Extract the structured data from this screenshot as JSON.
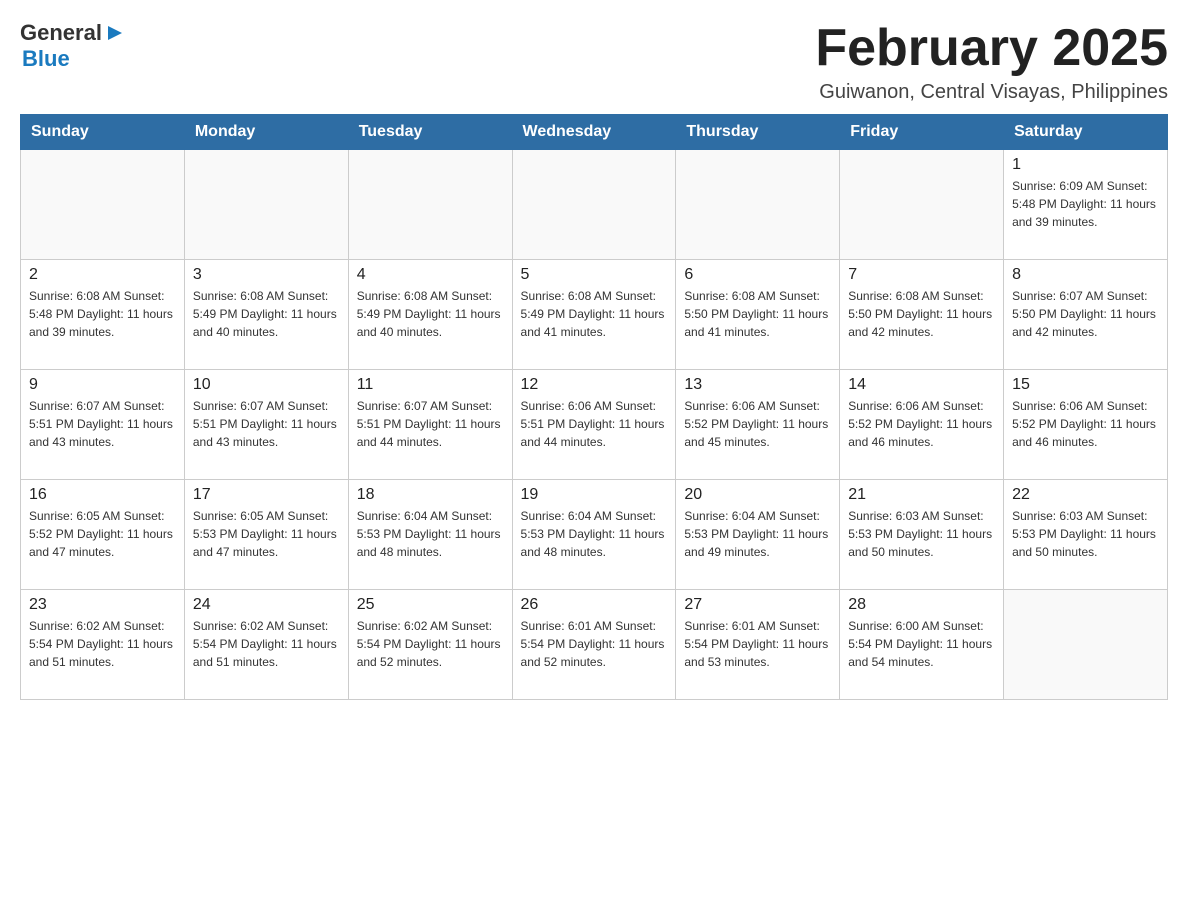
{
  "header": {
    "logo": {
      "text_general": "General",
      "arrow_symbol": "▶",
      "text_blue": "Blue"
    },
    "title": "February 2025",
    "subtitle": "Guiwanon, Central Visayas, Philippines"
  },
  "days_of_week": [
    "Sunday",
    "Monday",
    "Tuesday",
    "Wednesday",
    "Thursday",
    "Friday",
    "Saturday"
  ],
  "weeks": [
    {
      "days": [
        {
          "date": "",
          "info": ""
        },
        {
          "date": "",
          "info": ""
        },
        {
          "date": "",
          "info": ""
        },
        {
          "date": "",
          "info": ""
        },
        {
          "date": "",
          "info": ""
        },
        {
          "date": "",
          "info": ""
        },
        {
          "date": "1",
          "info": "Sunrise: 6:09 AM\nSunset: 5:48 PM\nDaylight: 11 hours and 39 minutes."
        }
      ]
    },
    {
      "days": [
        {
          "date": "2",
          "info": "Sunrise: 6:08 AM\nSunset: 5:48 PM\nDaylight: 11 hours and 39 minutes."
        },
        {
          "date": "3",
          "info": "Sunrise: 6:08 AM\nSunset: 5:49 PM\nDaylight: 11 hours and 40 minutes."
        },
        {
          "date": "4",
          "info": "Sunrise: 6:08 AM\nSunset: 5:49 PM\nDaylight: 11 hours and 40 minutes."
        },
        {
          "date": "5",
          "info": "Sunrise: 6:08 AM\nSunset: 5:49 PM\nDaylight: 11 hours and 41 minutes."
        },
        {
          "date": "6",
          "info": "Sunrise: 6:08 AM\nSunset: 5:50 PM\nDaylight: 11 hours and 41 minutes."
        },
        {
          "date": "7",
          "info": "Sunrise: 6:08 AM\nSunset: 5:50 PM\nDaylight: 11 hours and 42 minutes."
        },
        {
          "date": "8",
          "info": "Sunrise: 6:07 AM\nSunset: 5:50 PM\nDaylight: 11 hours and 42 minutes."
        }
      ]
    },
    {
      "days": [
        {
          "date": "9",
          "info": "Sunrise: 6:07 AM\nSunset: 5:51 PM\nDaylight: 11 hours and 43 minutes."
        },
        {
          "date": "10",
          "info": "Sunrise: 6:07 AM\nSunset: 5:51 PM\nDaylight: 11 hours and 43 minutes."
        },
        {
          "date": "11",
          "info": "Sunrise: 6:07 AM\nSunset: 5:51 PM\nDaylight: 11 hours and 44 minutes."
        },
        {
          "date": "12",
          "info": "Sunrise: 6:06 AM\nSunset: 5:51 PM\nDaylight: 11 hours and 44 minutes."
        },
        {
          "date": "13",
          "info": "Sunrise: 6:06 AM\nSunset: 5:52 PM\nDaylight: 11 hours and 45 minutes."
        },
        {
          "date": "14",
          "info": "Sunrise: 6:06 AM\nSunset: 5:52 PM\nDaylight: 11 hours and 46 minutes."
        },
        {
          "date": "15",
          "info": "Sunrise: 6:06 AM\nSunset: 5:52 PM\nDaylight: 11 hours and 46 minutes."
        }
      ]
    },
    {
      "days": [
        {
          "date": "16",
          "info": "Sunrise: 6:05 AM\nSunset: 5:52 PM\nDaylight: 11 hours and 47 minutes."
        },
        {
          "date": "17",
          "info": "Sunrise: 6:05 AM\nSunset: 5:53 PM\nDaylight: 11 hours and 47 minutes."
        },
        {
          "date": "18",
          "info": "Sunrise: 6:04 AM\nSunset: 5:53 PM\nDaylight: 11 hours and 48 minutes."
        },
        {
          "date": "19",
          "info": "Sunrise: 6:04 AM\nSunset: 5:53 PM\nDaylight: 11 hours and 48 minutes."
        },
        {
          "date": "20",
          "info": "Sunrise: 6:04 AM\nSunset: 5:53 PM\nDaylight: 11 hours and 49 minutes."
        },
        {
          "date": "21",
          "info": "Sunrise: 6:03 AM\nSunset: 5:53 PM\nDaylight: 11 hours and 50 minutes."
        },
        {
          "date": "22",
          "info": "Sunrise: 6:03 AM\nSunset: 5:53 PM\nDaylight: 11 hours and 50 minutes."
        }
      ]
    },
    {
      "days": [
        {
          "date": "23",
          "info": "Sunrise: 6:02 AM\nSunset: 5:54 PM\nDaylight: 11 hours and 51 minutes."
        },
        {
          "date": "24",
          "info": "Sunrise: 6:02 AM\nSunset: 5:54 PM\nDaylight: 11 hours and 51 minutes."
        },
        {
          "date": "25",
          "info": "Sunrise: 6:02 AM\nSunset: 5:54 PM\nDaylight: 11 hours and 52 minutes."
        },
        {
          "date": "26",
          "info": "Sunrise: 6:01 AM\nSunset: 5:54 PM\nDaylight: 11 hours and 52 minutes."
        },
        {
          "date": "27",
          "info": "Sunrise: 6:01 AM\nSunset: 5:54 PM\nDaylight: 11 hours and 53 minutes."
        },
        {
          "date": "28",
          "info": "Sunrise: 6:00 AM\nSunset: 5:54 PM\nDaylight: 11 hours and 54 minutes."
        },
        {
          "date": "",
          "info": ""
        }
      ]
    }
  ]
}
